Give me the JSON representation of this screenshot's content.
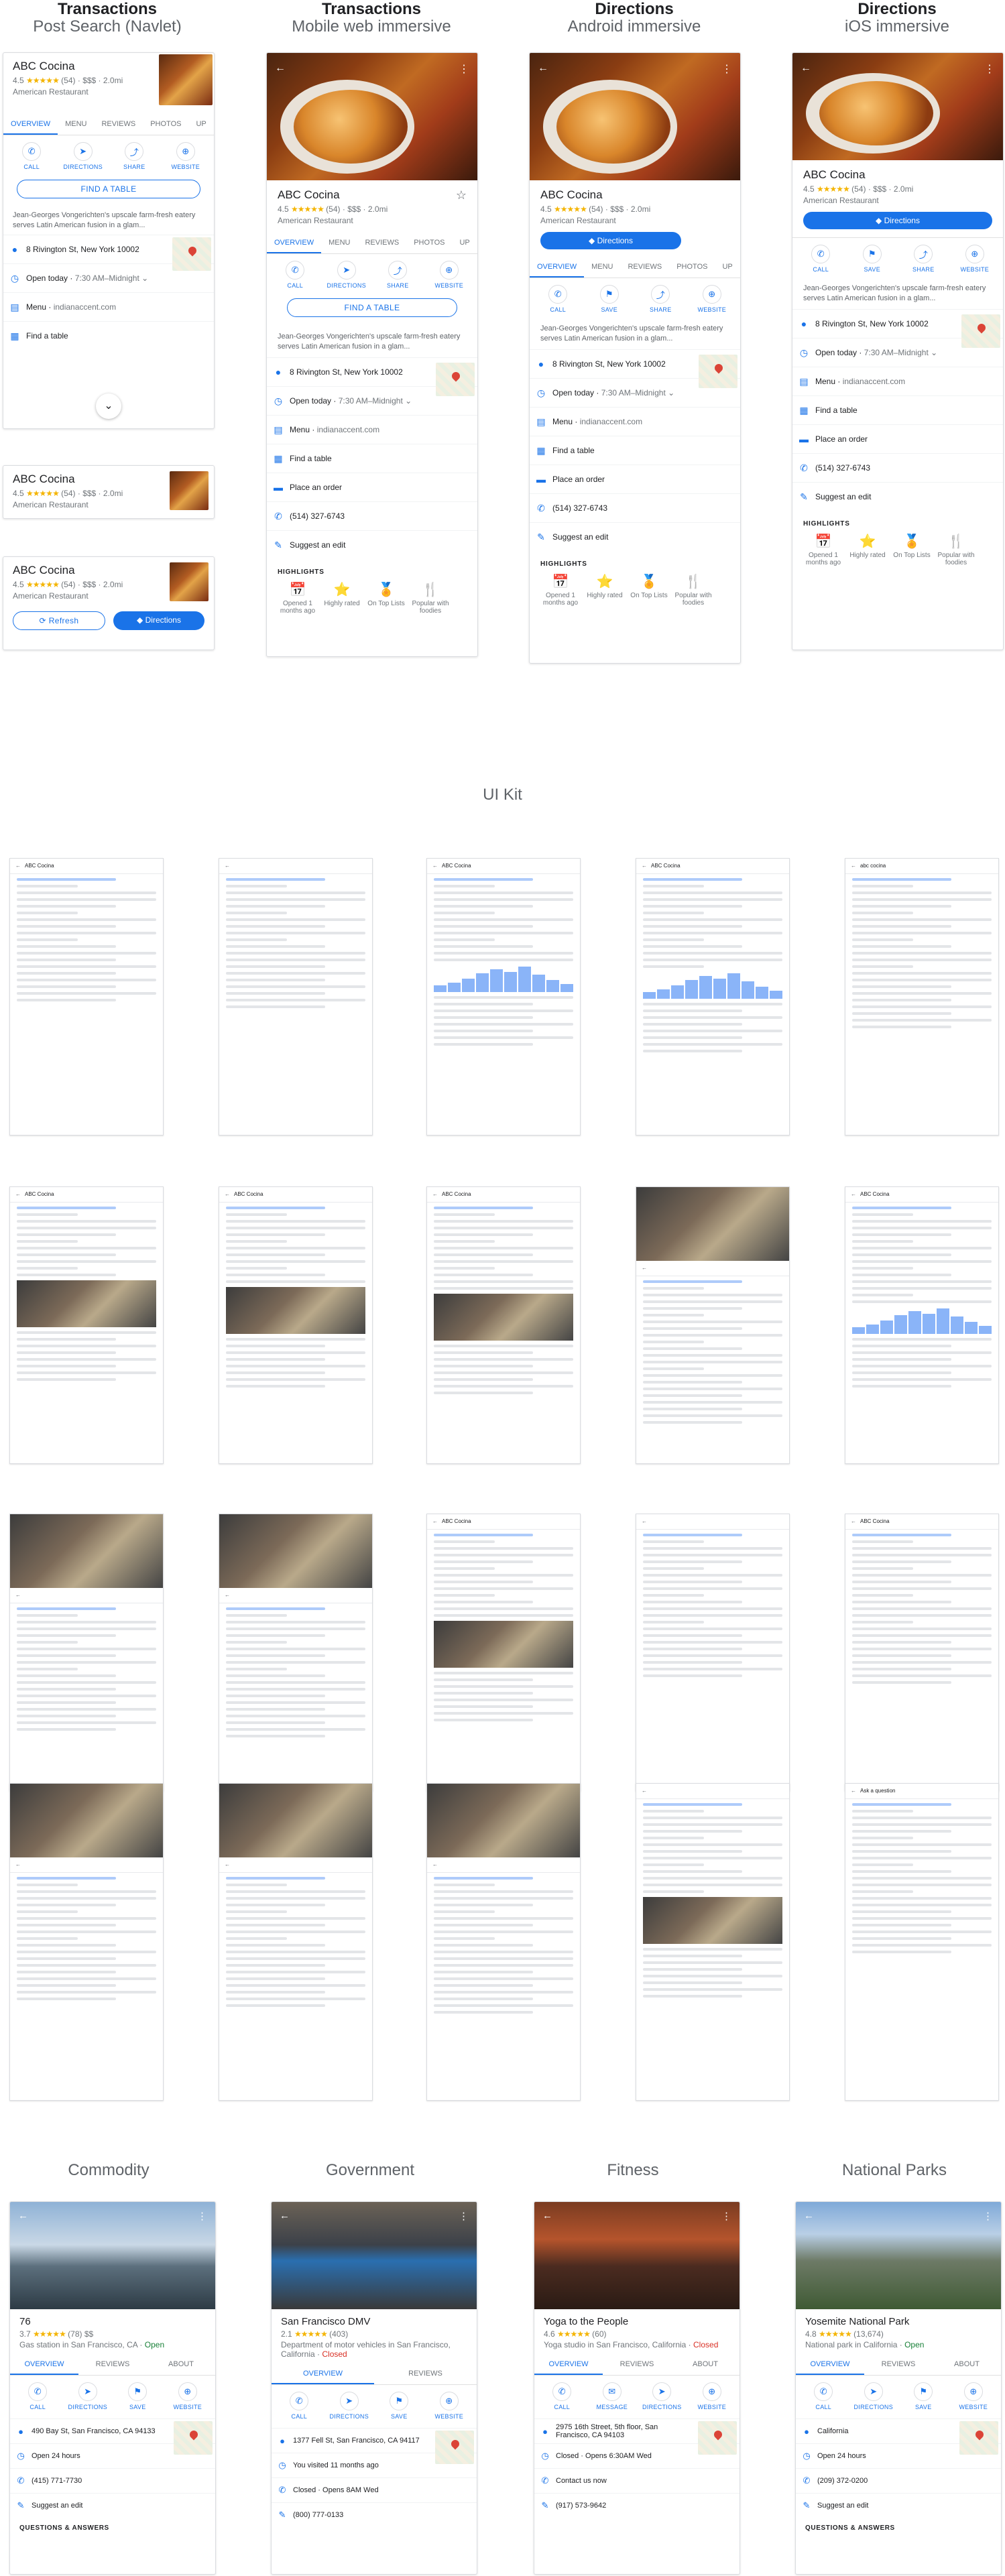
{
  "columns": [
    {
      "title": "Transactions",
      "subtitle": "Post Search (Navlet)"
    },
    {
      "title": "Transactions",
      "subtitle": "Mobile web immersive"
    },
    {
      "title": "Directions",
      "subtitle": "Android immersive"
    },
    {
      "title": "Directions",
      "subtitle": "iOS immersive"
    }
  ],
  "place": {
    "name": "ABC Cocina",
    "rating": "4.5",
    "stars": "★★★★★",
    "reviews": "(54)",
    "price": "$$$",
    "distance": "2.0mi",
    "category": "American Restaurant",
    "description": "Jean-Georges Vongerichten's upscale farm-fresh eatery serves Latin American fusion in a glam...",
    "address": "8 Rivington St, New York 10002",
    "hours_status": "Open today",
    "hours": "7:30 AM–Midnight",
    "menu_label": "Menu",
    "menu_url": "indianaccent.com",
    "find_table": "Find a table",
    "place_order": "Place an order",
    "phone": "(514) 327-6743",
    "suggest_edit": "Suggest an edit"
  },
  "tabs": [
    "OVERVIEW",
    "MENU",
    "REVIEWS",
    "PHOTOS",
    "UP"
  ],
  "actions": {
    "call": "CALL",
    "directions": "DIRECTIONS",
    "share": "SHARE",
    "website": "WEBSITE",
    "save": "SAVE"
  },
  "buttons": {
    "find_table": "FIND A TABLE",
    "directions": "Directions",
    "refresh": "Refresh"
  },
  "highlights": {
    "heading": "HIGHLIGHTS",
    "items": [
      "Opened 1 months ago",
      "Highly rated",
      "On Top Lists",
      "Popular with foodies"
    ]
  },
  "ui_kit": {
    "title": "UI Kit",
    "panels": [
      "ABC Cocina",
      "",
      "ABC Cocina",
      "ABC Cocina",
      "abc cocina",
      "ABC Cocina",
      "ABC Cocina",
      "ABC Cocina",
      "",
      "ABC Cocina",
      "",
      "",
      "ABC Cocina",
      "",
      "ABC Cocina",
      "",
      "",
      "",
      "",
      "Ask a question"
    ]
  },
  "categories": [
    {
      "title": "Commodity",
      "name": "76",
      "rating": "3.7",
      "reviews": "(78)",
      "price": "$$",
      "category": "Gas station in San Francisco, CA",
      "status": "Open",
      "tabs": [
        "OVERVIEW",
        "REVIEWS",
        "ABOUT"
      ],
      "actions": [
        "CALL",
        "DIRECTIONS",
        "SAVE",
        "WEBSITE"
      ],
      "rows": [
        "490 Bay St, San Francisco, CA 94133",
        "Open 24 hours",
        "(415) 771-7730",
        "Suggest an edit"
      ],
      "footer": "QUESTIONS & ANSWERS"
    },
    {
      "title": "Government",
      "name": "San Francisco DMV",
      "rating": "2.1",
      "reviews": "(403)",
      "price": "",
      "category": "Department of motor vehicles in San Francisco, California",
      "status": "Closed",
      "tabs": [
        "OVERVIEW",
        "REVIEWS"
      ],
      "actions": [
        "CALL",
        "DIRECTIONS",
        "SAVE",
        "WEBSITE"
      ],
      "rows": [
        "1377 Fell St, San Francisco, CA 94117",
        "You visited 11 months ago",
        "Closed · Opens 8AM Wed",
        "(800) 777-0133"
      ],
      "footer": ""
    },
    {
      "title": "Fitness",
      "name": "Yoga to the People",
      "rating": "4.6",
      "reviews": "(60)",
      "price": "",
      "category": "Yoga studio in San Francisco, California",
      "status": "Closed",
      "tabs": [
        "OVERVIEW",
        "REVIEWS",
        "ABOUT"
      ],
      "actions": [
        "CALL",
        "MESSAGE",
        "DIRECTIONS",
        "WEBSITE"
      ],
      "rows": [
        "2975 16th Street, 5th floor, San Francisco, CA 94103",
        "Closed · Opens 6:30AM Wed",
        "Contact us now",
        "(917) 573-9642"
      ],
      "footer": ""
    },
    {
      "title": "National Parks",
      "name": "Yosemite National Park",
      "rating": "4.8",
      "reviews": "(13,674)",
      "price": "",
      "category": "National park in California",
      "status": "Open",
      "tabs": [
        "OVERVIEW",
        "REVIEWS",
        "ABOUT"
      ],
      "actions": [
        "CALL",
        "DIRECTIONS",
        "SAVE",
        "WEBSITE"
      ],
      "rows": [
        "California",
        "Open 24 hours",
        "(209) 372-0200",
        "Suggest an edit"
      ],
      "footer": "QUESTIONS & ANSWERS"
    }
  ],
  "colors": {
    "accent": "#1a73e8",
    "star": "#f4b400",
    "open": "#188038",
    "closed": "#d93025"
  }
}
